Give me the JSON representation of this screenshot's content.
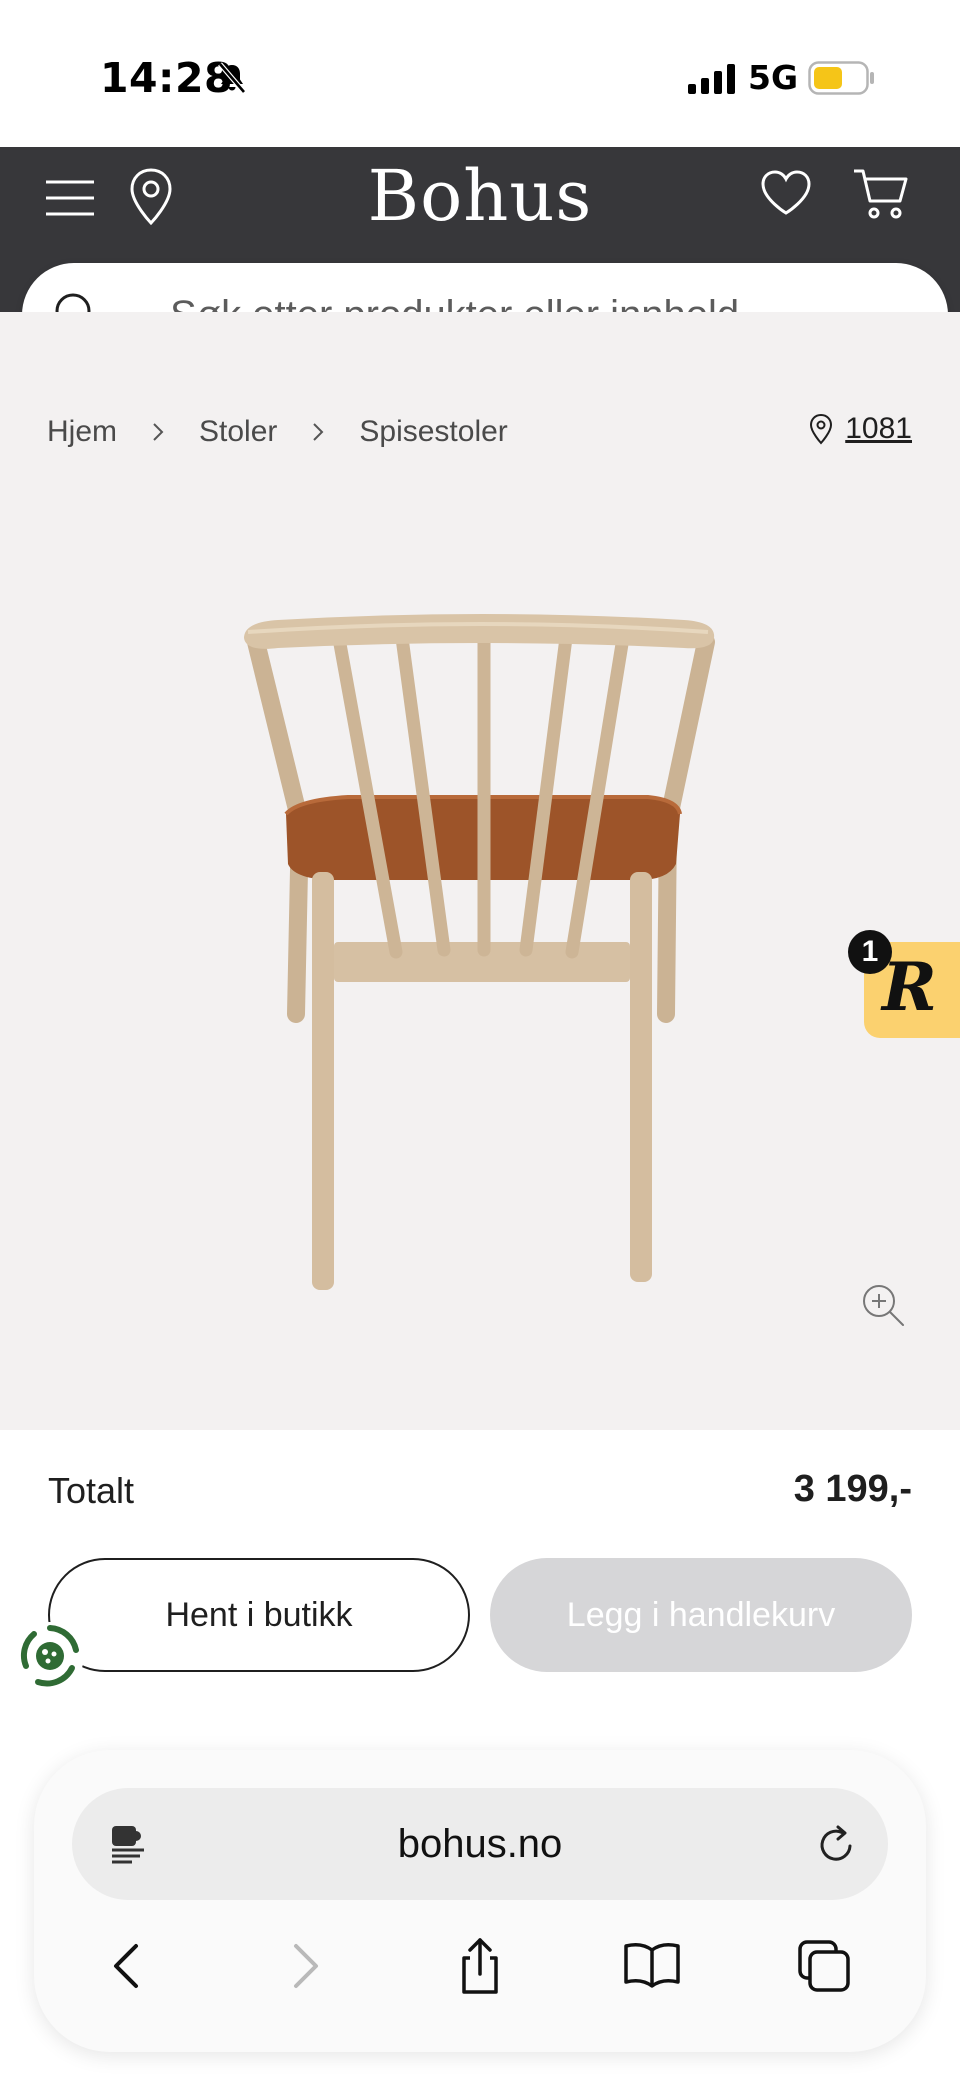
{
  "status_bar": {
    "time": "14:28",
    "network": "5G",
    "battery_color": "#f5c518"
  },
  "header": {
    "brand": "Bohus",
    "background": "#37373a"
  },
  "search": {
    "placeholder": "Søk etter produkter eller innhold ..."
  },
  "breadcrumb": {
    "items": [
      "Hjem",
      "Stoler",
      "Spisestoler"
    ]
  },
  "store": {
    "code": "1081"
  },
  "badge": {
    "count": "1",
    "letter": "R",
    "color": "#fbd16f"
  },
  "purchase": {
    "total_label": "Totalt",
    "total_price": "3 199,-",
    "pickup_label": "Hent i butikk",
    "cart_label": "Legg i handlekurv"
  },
  "browser": {
    "url": "bohus.no"
  }
}
